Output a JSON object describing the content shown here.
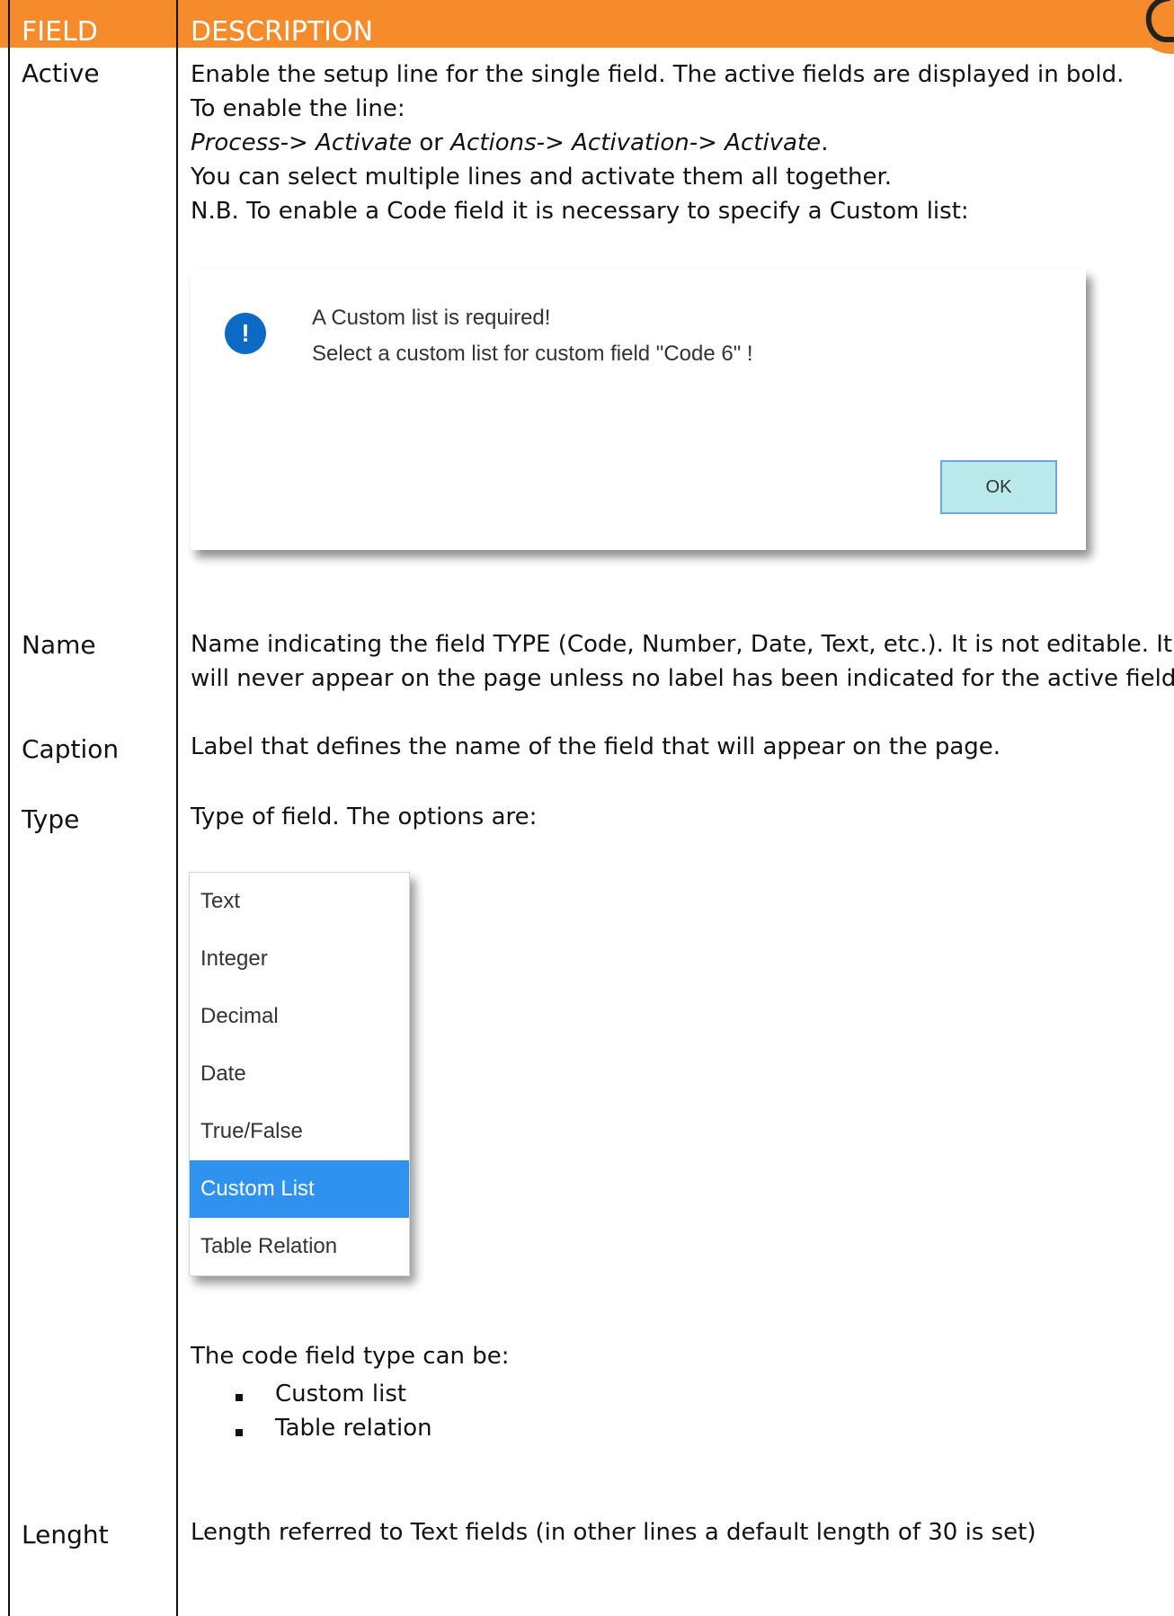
{
  "header": {
    "field_col": "FIELD",
    "desc_col": "DESCRIPTION"
  },
  "rows": {
    "active": {
      "label": "Active",
      "line1": "Enable the setup line for the single field. The active fields are displayed in bold.",
      "line2": "To enable the line:",
      "line3_a": "Process-> Activate",
      "line3_b": " or ",
      "line3_c": "Actions-> Activation-> Activate",
      "line3_d": ".",
      "line4": "You can select multiple lines and activate them all together.",
      "line5": "N.B. To enable a Code field it is necessary to specify a Custom list:"
    },
    "name": {
      "label": "Name",
      "line1": "Name indicating the field TYPE (Code, Number, Date, Text, etc.). It is not editable. It",
      "line2": "will never appear on the page unless no label has been indicated for the active field."
    },
    "caption": {
      "label": "Caption",
      "line1": "Label that defines the name of the field that will appear on the page."
    },
    "type": {
      "label": "Type",
      "line1": "Type of field. The options are:",
      "code_intro": "The code field type can be:",
      "bullets": [
        "Custom list",
        "Table relation"
      ]
    },
    "length": {
      "label": "Lenght",
      "line1": "Length referred to Text fields (in other lines a default length of 30 is set)"
    }
  },
  "dialog": {
    "icon": "!",
    "title": "A Custom list is required!",
    "message": "Select a custom list for custom field \"Code 6\" !",
    "ok_label": "OK"
  },
  "dropdown": {
    "options": [
      "Text",
      "Integer",
      "Decimal",
      "Date",
      "True/False",
      "Custom List",
      "Table Relation"
    ],
    "selected": "Custom List"
  },
  "colors": {
    "header_bg": "#f68b2c",
    "dialog_icon": "#0b6ac4",
    "ok_button_bg": "#b9e9ea",
    "dropdown_selected": "#2e92ee"
  }
}
